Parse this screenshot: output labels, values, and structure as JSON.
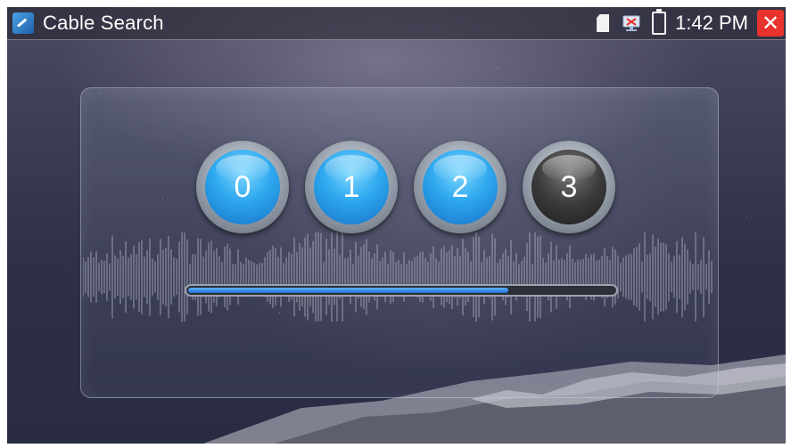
{
  "statusbar": {
    "app_title": "Cable Search",
    "app_icon": "cable-search-app-icon",
    "clock": "1:42 PM",
    "icons": [
      "sd-card-icon",
      "network-icon",
      "battery-icon"
    ],
    "close_icon": "close-icon",
    "close_symbol": "✕"
  },
  "counter": {
    "buttons": [
      {
        "label": "0",
        "state": "active"
      },
      {
        "label": "1",
        "state": "active"
      },
      {
        "label": "2",
        "state": "active"
      },
      {
        "label": "3",
        "state": "inactive"
      }
    ]
  },
  "progress": {
    "percent": 75
  },
  "colors": {
    "accent": "#2ea8ee",
    "close": "#e8322c",
    "progress": "#1f6fd6"
  }
}
